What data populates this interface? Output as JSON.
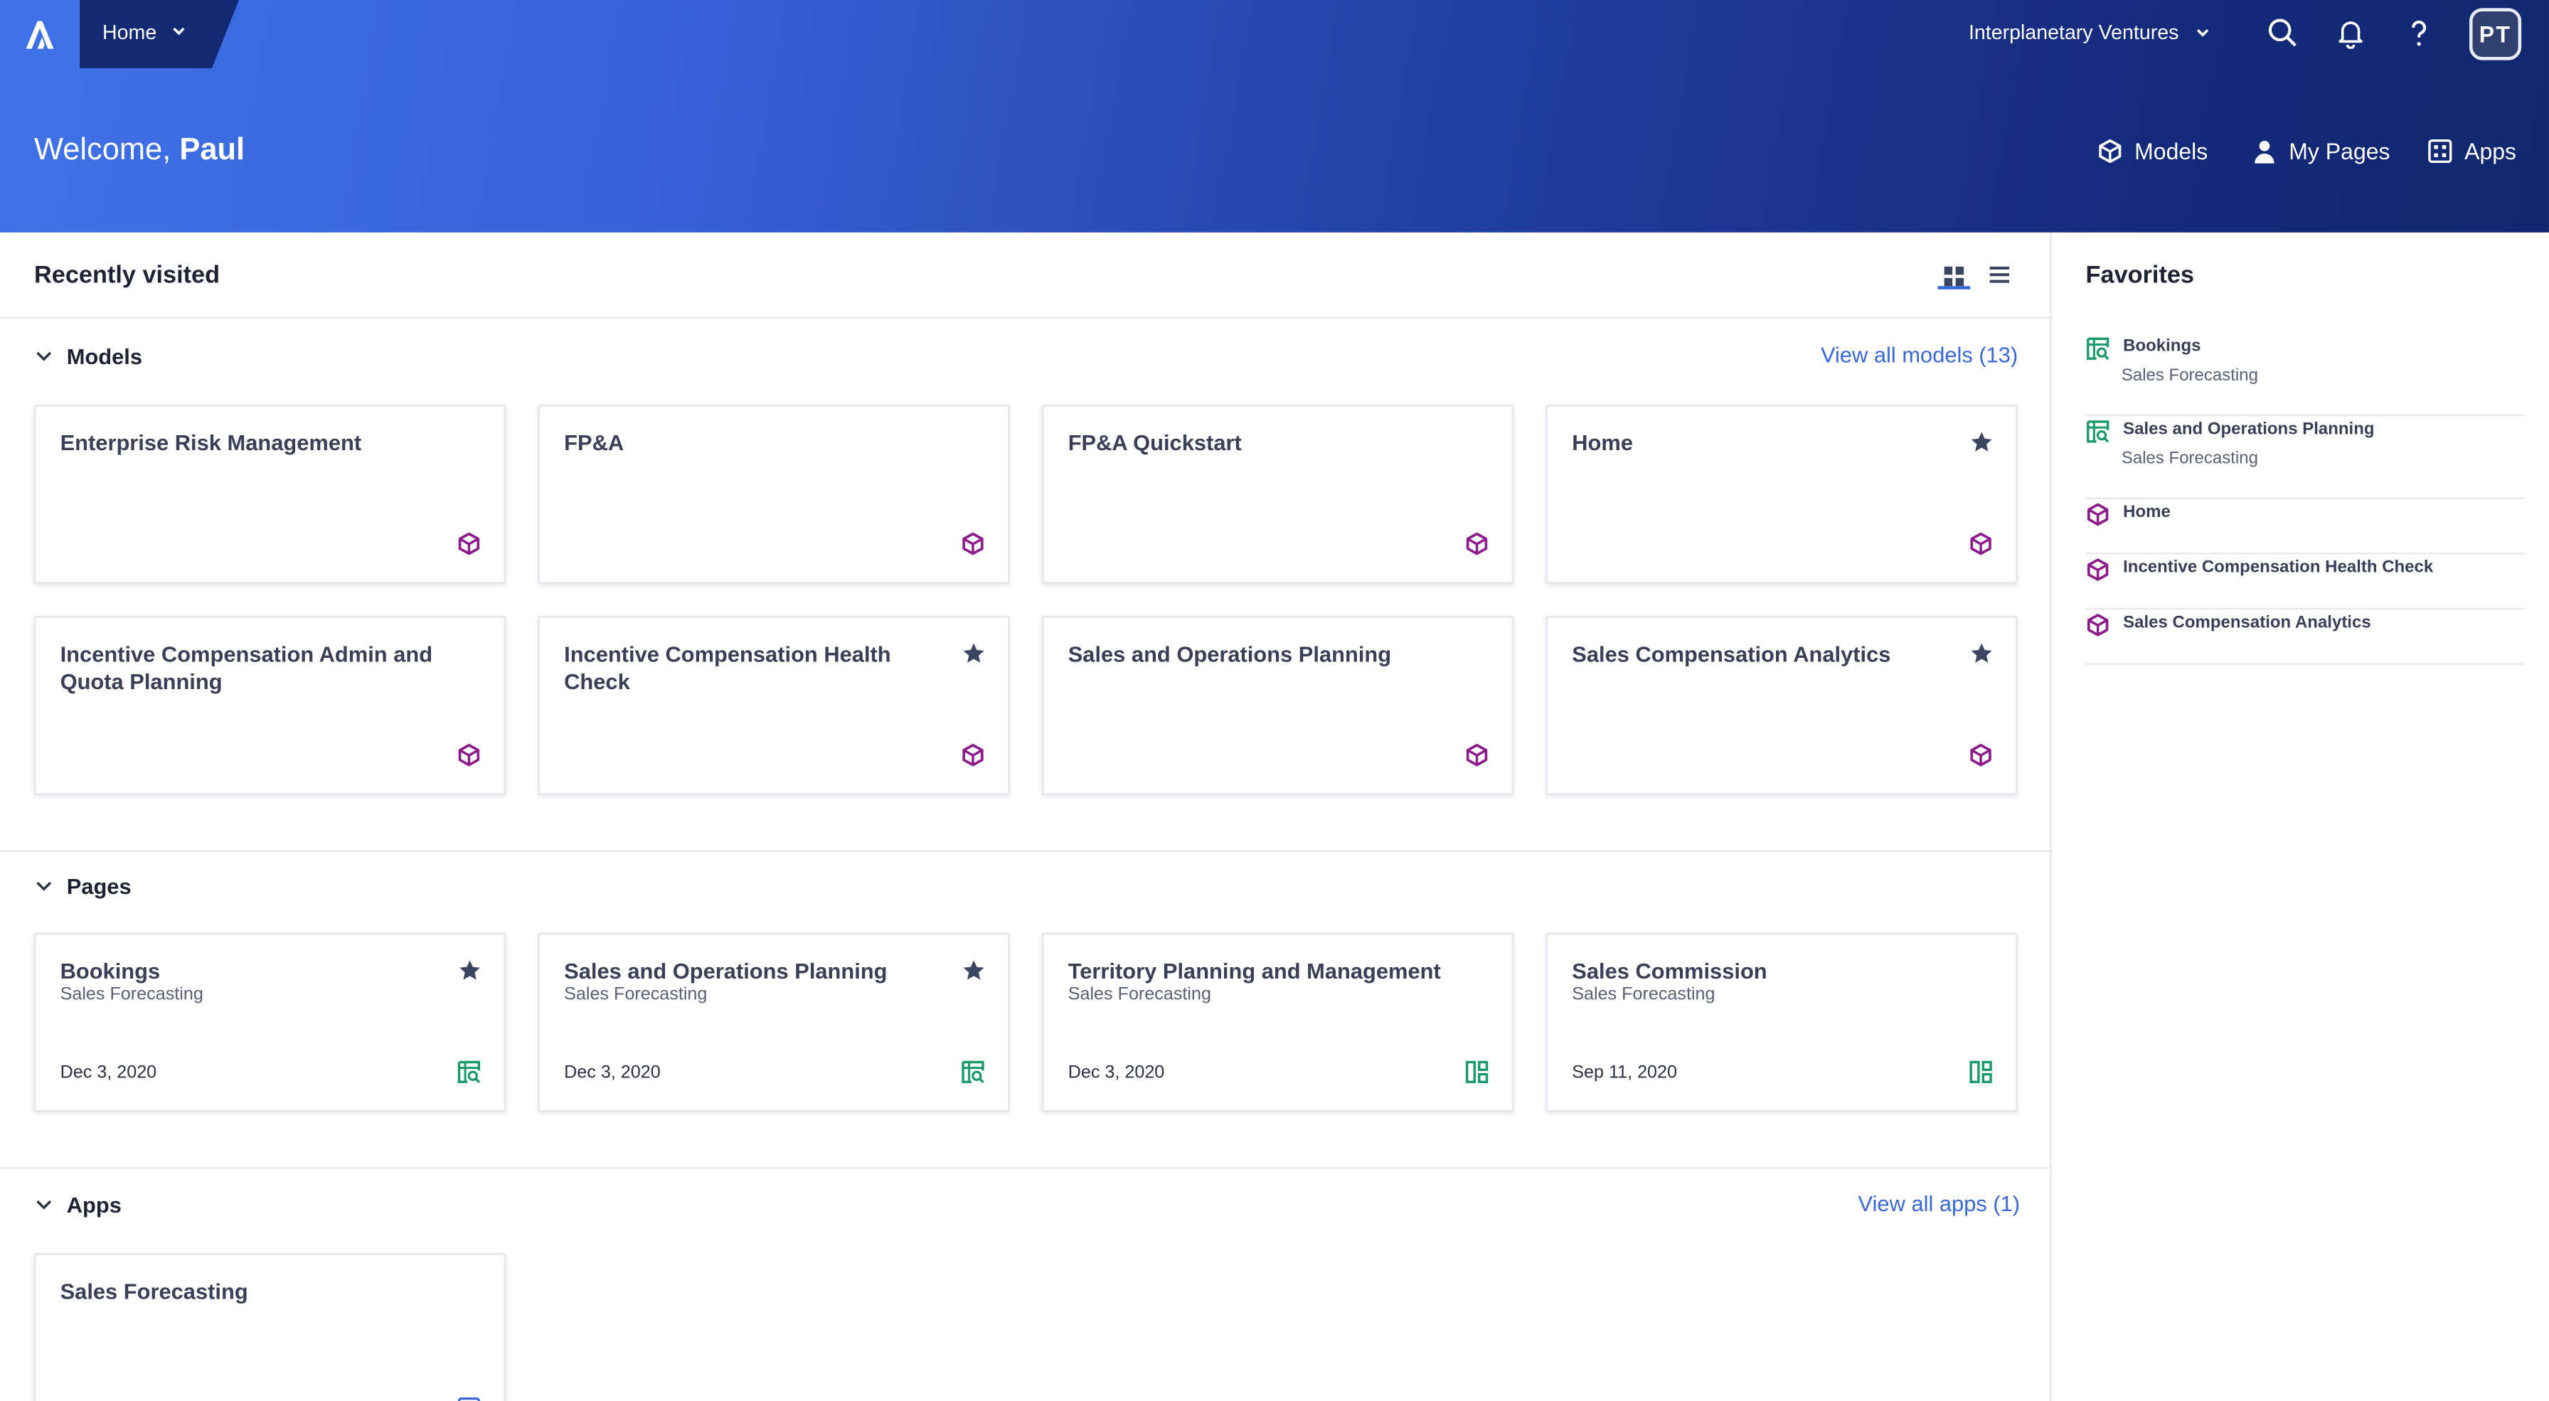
{
  "header": {
    "home_tab": "Home",
    "org": "Interplanetary Ventures",
    "avatar": "PT",
    "welcome_prefix": "Welcome, ",
    "welcome_name": "Paul",
    "nav": {
      "models": "Models",
      "my_pages": "My Pages",
      "apps": "Apps"
    }
  },
  "main": {
    "recently_visited": "Recently visited",
    "models": {
      "title": "Models",
      "view_all": "View all models (13)",
      "cards": [
        {
          "title": "Enterprise Risk Management",
          "starred": false
        },
        {
          "title": "FP&A",
          "starred": false
        },
        {
          "title": "FP&A Quickstart",
          "starred": false
        },
        {
          "title": "Home",
          "starred": true
        },
        {
          "title": "Incentive Compensation Admin and Quota Planning",
          "starred": false
        },
        {
          "title": "Incentive Compensation Health Check",
          "starred": true
        },
        {
          "title": "Sales and Operations Planning",
          "starred": false
        },
        {
          "title": "Sales Compensation Analytics",
          "starred": true
        }
      ]
    },
    "pages": {
      "title": "Pages",
      "cards": [
        {
          "title": "Bookings",
          "subtitle": "Sales Forecasting",
          "date": "Dec 3, 2020",
          "starred": true,
          "icon": "grid-page-icon"
        },
        {
          "title": "Sales and Operations Planning",
          "subtitle": "Sales Forecasting",
          "date": "Dec 3, 2020",
          "starred": true,
          "icon": "grid-page-icon"
        },
        {
          "title": "Territory Planning and Management",
          "subtitle": "Sales Forecasting",
          "date": "Dec 3, 2020",
          "starred": false,
          "icon": "board-page-icon"
        },
        {
          "title": "Sales Commission",
          "subtitle": "Sales Forecasting",
          "date": "Sep 11, 2020",
          "starred": false,
          "icon": "board-page-icon"
        }
      ]
    },
    "apps": {
      "title": "Apps",
      "view_all": "View all apps (1)",
      "cards": [
        {
          "title": "Sales Forecasting",
          "icon": "app-icon"
        }
      ]
    }
  },
  "favorites": {
    "title": "Favorites",
    "items": [
      {
        "name": "Bookings",
        "sub": "Sales Forecasting",
        "icon": "grid-page-icon"
      },
      {
        "name": "Sales and Operations Planning",
        "sub": "Sales Forecasting",
        "icon": "grid-page-icon"
      },
      {
        "name": "Home",
        "sub": "",
        "icon": "model-cube-icon"
      },
      {
        "name": "Incentive Compensation Health Check",
        "sub": "",
        "icon": "model-cube-icon"
      },
      {
        "name": "Sales Compensation Analytics",
        "sub": "",
        "icon": "model-cube-icon"
      }
    ]
  },
  "colors": {
    "model_icon": "#8b1a8b",
    "page_icon": "#1a9a6a",
    "app_icon": "#3767d8",
    "star": "#3a4560",
    "link": "#3a68d8"
  }
}
